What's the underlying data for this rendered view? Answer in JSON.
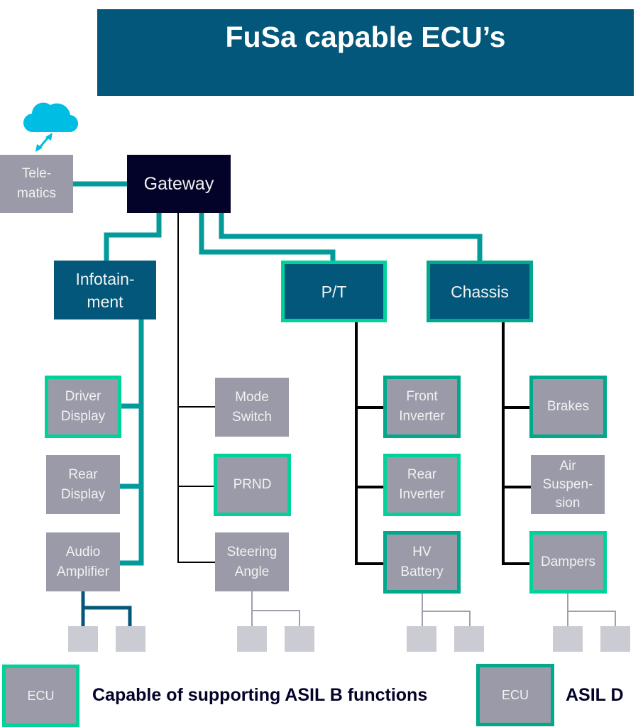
{
  "title": "FuSa capable ECU’s",
  "colors": {
    "title_bg": "#02577a",
    "gateway_bg": "#03032a",
    "domain_bg": "#02577a",
    "ecu_bg": "#9b9aa8",
    "leaf_bg": "#cbcbd3",
    "asil_b_border": "#00d39a",
    "asil_d_border": "#00a98a",
    "teal_link": "#039a9a",
    "cloud": "#00bde3"
  },
  "nodes": {
    "telematics": {
      "label": "Tele-\nmatics",
      "asil": "none"
    },
    "gateway": {
      "label": "Gateway",
      "asil": "none"
    },
    "infotainment": {
      "label": "Infotain-\nment",
      "asil": "none"
    },
    "pt": {
      "label": "P/T",
      "asil": "B"
    },
    "chassis": {
      "label": "Chassis",
      "asil": "D"
    },
    "driver_display": {
      "label": "Driver\nDisplay",
      "asil": "B"
    },
    "rear_display": {
      "label": "Rear\nDisplay",
      "asil": "none"
    },
    "audio_amplifier": {
      "label": "Audio\nAmplifier",
      "asil": "none"
    },
    "mode_switch": {
      "label": "Mode\nSwitch",
      "asil": "none"
    },
    "prnd": {
      "label": "PRND",
      "asil": "B"
    },
    "steering_angle": {
      "label": "Steering\nAngle",
      "asil": "none"
    },
    "front_inverter": {
      "label": "Front\nInverter",
      "asil": "D"
    },
    "rear_inverter": {
      "label": "Rear\nInverter",
      "asil": "B"
    },
    "hv_battery": {
      "label": "HV\nBattery",
      "asil": "D"
    },
    "brakes": {
      "label": "Brakes",
      "asil": "D"
    },
    "air_suspension": {
      "label": "Air\nSuspen-\nsion",
      "asil": "none"
    },
    "dampers": {
      "label": "Dampers",
      "asil": "B"
    }
  },
  "legend": {
    "asil_b": {
      "box_label": "ECU",
      "text": "Capable of supporting ASIL B functions"
    },
    "asil_d": {
      "box_label": "ECU",
      "text": "ASIL D"
    }
  }
}
